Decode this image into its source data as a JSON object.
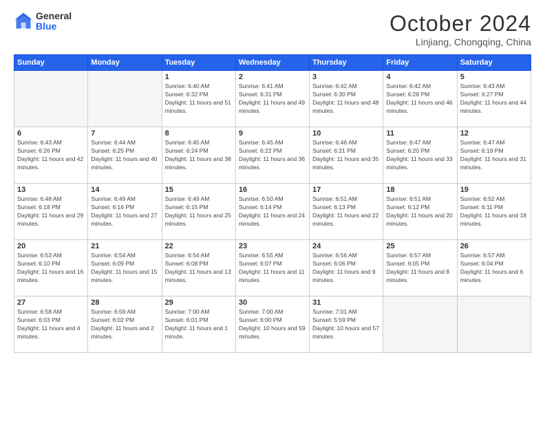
{
  "header": {
    "logo_general": "General",
    "logo_blue": "Blue",
    "month_title": "October 2024",
    "location": "Linjiang, Chongqing, China"
  },
  "weekdays": [
    "Sunday",
    "Monday",
    "Tuesday",
    "Wednesday",
    "Thursday",
    "Friday",
    "Saturday"
  ],
  "weeks": [
    [
      {
        "day": "",
        "empty": true
      },
      {
        "day": "",
        "empty": true
      },
      {
        "day": "1",
        "sunrise": "Sunrise: 6:40 AM",
        "sunset": "Sunset: 6:32 PM",
        "daylight": "Daylight: 11 hours and 51 minutes."
      },
      {
        "day": "2",
        "sunrise": "Sunrise: 6:41 AM",
        "sunset": "Sunset: 6:31 PM",
        "daylight": "Daylight: 11 hours and 49 minutes."
      },
      {
        "day": "3",
        "sunrise": "Sunrise: 6:42 AM",
        "sunset": "Sunset: 6:30 PM",
        "daylight": "Daylight: 11 hours and 48 minutes."
      },
      {
        "day": "4",
        "sunrise": "Sunrise: 6:42 AM",
        "sunset": "Sunset: 6:28 PM",
        "daylight": "Daylight: 11 hours and 46 minutes."
      },
      {
        "day": "5",
        "sunrise": "Sunrise: 6:43 AM",
        "sunset": "Sunset: 6:27 PM",
        "daylight": "Daylight: 11 hours and 44 minutes."
      }
    ],
    [
      {
        "day": "6",
        "sunrise": "Sunrise: 6:43 AM",
        "sunset": "Sunset: 6:26 PM",
        "daylight": "Daylight: 11 hours and 42 minutes."
      },
      {
        "day": "7",
        "sunrise": "Sunrise: 6:44 AM",
        "sunset": "Sunset: 6:25 PM",
        "daylight": "Daylight: 11 hours and 40 minutes."
      },
      {
        "day": "8",
        "sunrise": "Sunrise: 6:45 AM",
        "sunset": "Sunset: 6:24 PM",
        "daylight": "Daylight: 11 hours and 38 minutes."
      },
      {
        "day": "9",
        "sunrise": "Sunrise: 6:45 AM",
        "sunset": "Sunset: 6:22 PM",
        "daylight": "Daylight: 11 hours and 36 minutes."
      },
      {
        "day": "10",
        "sunrise": "Sunrise: 6:46 AM",
        "sunset": "Sunset: 6:21 PM",
        "daylight": "Daylight: 11 hours and 35 minutes."
      },
      {
        "day": "11",
        "sunrise": "Sunrise: 6:47 AM",
        "sunset": "Sunset: 6:20 PM",
        "daylight": "Daylight: 11 hours and 33 minutes."
      },
      {
        "day": "12",
        "sunrise": "Sunrise: 6:47 AM",
        "sunset": "Sunset: 6:19 PM",
        "daylight": "Daylight: 11 hours and 31 minutes."
      }
    ],
    [
      {
        "day": "13",
        "sunrise": "Sunrise: 6:48 AM",
        "sunset": "Sunset: 6:18 PM",
        "daylight": "Daylight: 11 hours and 29 minutes."
      },
      {
        "day": "14",
        "sunrise": "Sunrise: 6:49 AM",
        "sunset": "Sunset: 6:16 PM",
        "daylight": "Daylight: 11 hours and 27 minutes."
      },
      {
        "day": "15",
        "sunrise": "Sunrise: 6:49 AM",
        "sunset": "Sunset: 6:15 PM",
        "daylight": "Daylight: 11 hours and 25 minutes."
      },
      {
        "day": "16",
        "sunrise": "Sunrise: 6:50 AM",
        "sunset": "Sunset: 6:14 PM",
        "daylight": "Daylight: 11 hours and 24 minutes."
      },
      {
        "day": "17",
        "sunrise": "Sunrise: 6:51 AM",
        "sunset": "Sunset: 6:13 PM",
        "daylight": "Daylight: 11 hours and 22 minutes."
      },
      {
        "day": "18",
        "sunrise": "Sunrise: 6:51 AM",
        "sunset": "Sunset: 6:12 PM",
        "daylight": "Daylight: 11 hours and 20 minutes."
      },
      {
        "day": "19",
        "sunrise": "Sunrise: 6:52 AM",
        "sunset": "Sunset: 6:11 PM",
        "daylight": "Daylight: 11 hours and 18 minutes."
      }
    ],
    [
      {
        "day": "20",
        "sunrise": "Sunrise: 6:53 AM",
        "sunset": "Sunset: 6:10 PM",
        "daylight": "Daylight: 11 hours and 16 minutes."
      },
      {
        "day": "21",
        "sunrise": "Sunrise: 6:54 AM",
        "sunset": "Sunset: 6:09 PM",
        "daylight": "Daylight: 11 hours and 15 minutes."
      },
      {
        "day": "22",
        "sunrise": "Sunrise: 6:54 AM",
        "sunset": "Sunset: 6:08 PM",
        "daylight": "Daylight: 11 hours and 13 minutes."
      },
      {
        "day": "23",
        "sunrise": "Sunrise: 6:55 AM",
        "sunset": "Sunset: 6:07 PM",
        "daylight": "Daylight: 11 hours and 11 minutes."
      },
      {
        "day": "24",
        "sunrise": "Sunrise: 6:56 AM",
        "sunset": "Sunset: 6:06 PM",
        "daylight": "Daylight: 11 hours and 9 minutes."
      },
      {
        "day": "25",
        "sunrise": "Sunrise: 6:57 AM",
        "sunset": "Sunset: 6:05 PM",
        "daylight": "Daylight: 11 hours and 8 minutes."
      },
      {
        "day": "26",
        "sunrise": "Sunrise: 6:57 AM",
        "sunset": "Sunset: 6:04 PM",
        "daylight": "Daylight: 11 hours and 6 minutes."
      }
    ],
    [
      {
        "day": "27",
        "sunrise": "Sunrise: 6:58 AM",
        "sunset": "Sunset: 6:03 PM",
        "daylight": "Daylight: 11 hours and 4 minutes."
      },
      {
        "day": "28",
        "sunrise": "Sunrise: 6:59 AM",
        "sunset": "Sunset: 6:02 PM",
        "daylight": "Daylight: 11 hours and 2 minutes."
      },
      {
        "day": "29",
        "sunrise": "Sunrise: 7:00 AM",
        "sunset": "Sunset: 6:01 PM",
        "daylight": "Daylight: 11 hours and 1 minute."
      },
      {
        "day": "30",
        "sunrise": "Sunrise: 7:00 AM",
        "sunset": "Sunset: 6:00 PM",
        "daylight": "Daylight: 10 hours and 59 minutes."
      },
      {
        "day": "31",
        "sunrise": "Sunrise: 7:01 AM",
        "sunset": "Sunset: 5:59 PM",
        "daylight": "Daylight: 10 hours and 57 minutes."
      },
      {
        "day": "",
        "empty": true
      },
      {
        "day": "",
        "empty": true
      }
    ]
  ]
}
